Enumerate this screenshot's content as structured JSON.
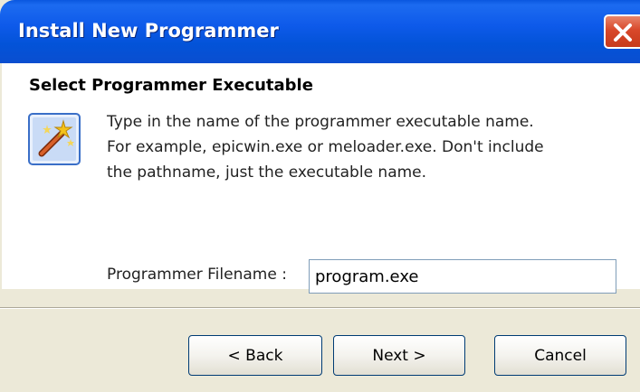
{
  "window": {
    "title": "Install New Programmer"
  },
  "section": {
    "title": "Select Programmer Executable"
  },
  "description": [
    "Type in the name of the programmer executable name.",
    "For example, epicwin.exe or meloader.exe.  Don't include",
    "the pathname, just the executable name."
  ],
  "field": {
    "label": "Programmer Filename :",
    "value": "program.exe"
  },
  "buttons": {
    "back": "< Back",
    "next": "Next >",
    "cancel": "Cancel"
  },
  "icons": {
    "close": "close-icon",
    "wizard": "wizard-wand-icon"
  },
  "colors": {
    "titlebar": "#0353D8",
    "close": "#D8482A",
    "dialog_bg": "#ECE9D8"
  }
}
